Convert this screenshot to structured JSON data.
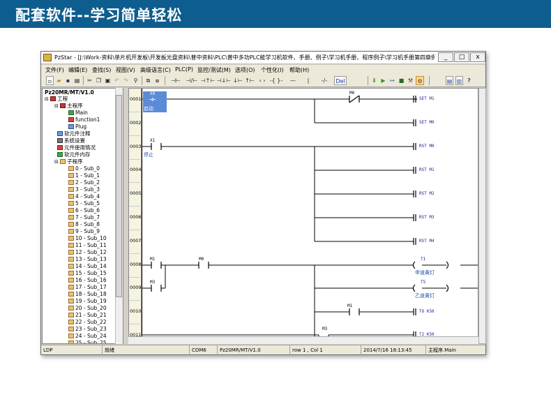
{
  "banner": {
    "title": "配套软件--学习简单轻松"
  },
  "window": {
    "title": "PzStar - [J:\\Work-资料\\单片机开发板\\开发板光盘资料\\普中资料\\PLC\\普中多功PLC能学习机软件、手册、例子\\学习机手册、程序例子\\学习机手册第四章例子\\红绿灯2.PSP...",
    "minimize": "_",
    "maximize": "□",
    "close": "x"
  },
  "menu": [
    "文件(F)",
    "编辑(E)",
    "查找(S)",
    "视图(V)",
    "高级语言(C)",
    "PLC(P)",
    "监控/测试(M)",
    "选项(O)",
    "个性化(I)",
    "帮助(H)"
  ],
  "toolbar": {
    "del_label": "Del",
    "contact_symbols": [
      "⊣⊢",
      "⊣/⊢",
      "⊣↑⊢",
      "⊣↓⊢",
      "↓⊢",
      "↑⊢",
      "‹ ›",
      "-{ }-",
      "—",
      "|",
      "-/-"
    ]
  },
  "tree": {
    "model": "Pz20MR/MT/V1.0",
    "project": "工程",
    "main_program": "主程序",
    "main": "Main",
    "function": "function1",
    "plug": "Plug",
    "soft_comment": "软元件注释",
    "system_setup": "系统设置",
    "element_usage": "元件使用情况",
    "soft_memory": "软元件内存",
    "subroutines": "子程序",
    "subs": [
      "0 - Sub_0",
      "1 - Sub_1",
      "2 - Sub_2",
      "3 - Sub_3",
      "4 - Sub_4",
      "5 - Sub_5",
      "6 - Sub_6",
      "7 - Sub_7",
      "8 - Sub_8",
      "9 - Sub_9",
      "10 - Sub_10",
      "11 - Sub_11",
      "12 - Sub_12",
      "13 - Sub_13",
      "14 - Sub_14",
      "15 - Sub_15",
      "16 - Sub_16",
      "17 - Sub_17",
      "18 - Sub_18",
      "19 - Sub_19",
      "20 - Sub_20",
      "21 - Sub_21",
      "22 - Sub_22",
      "23 - Sub_23",
      "24 - Sub_24",
      "25 - Sub_25"
    ]
  },
  "ladder": {
    "rungs": [
      "0001",
      "0002",
      "0003",
      "0004",
      "0005",
      "0006",
      "0007",
      "0008",
      "0009",
      "0010",
      "0011"
    ],
    "contact_x0": "X0",
    "comment_x0": "启动",
    "contact_m0_nc": "M0",
    "contact_x1": "X1",
    "comment_x1": "停止",
    "contact_m1": "M1",
    "contact_m0": "M0",
    "contact_m3": "M3",
    "contact_m1b": "M1",
    "contact_m3b": "M3",
    "coils": [
      "SET M1",
      "SET M0",
      "RST M0",
      "RST M1",
      "RST M2",
      "RST M3",
      "RST M4"
    ],
    "timer_t1": "T1",
    "comment_t1": "甲道黄灯",
    "timer_t5": "T5",
    "comment_t5": "乙道黄灯",
    "coil_t0": "TO K50",
    "coil_t2": "T2 K50"
  },
  "status": {
    "mode": "LDP",
    "state": "就绪",
    "port": "COM6",
    "model": "Pz20MR/MT/V1.0",
    "position": "row 1 , Col 1",
    "datetime": "2014/7/16 18:13:45",
    "program": "主程序.Main"
  }
}
